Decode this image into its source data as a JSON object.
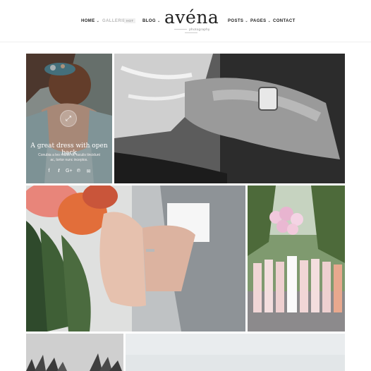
{
  "nav": {
    "home": "HOME",
    "galleries": "GALLERIES",
    "galleries_badge": "HOT",
    "blog": "BLOG",
    "posts": "POSTS",
    "pages": "PAGES",
    "contact": "CONTACT"
  },
  "logo": {
    "name": "avéna",
    "tagline": "photography"
  },
  "featured": {
    "title": "A great dress with open back",
    "text": "Conubia a leo mattis ut, iaculis tincidunt ac, tortor nunc inceptos.",
    "share_icons": [
      "facebook-icon",
      "twitter-icon",
      "google-plus-icon",
      "pinterest-icon",
      "mail-icon"
    ]
  },
  "colors": {
    "text": "#222222",
    "muted": "#b9b9b9",
    "rule": "#efefef"
  }
}
